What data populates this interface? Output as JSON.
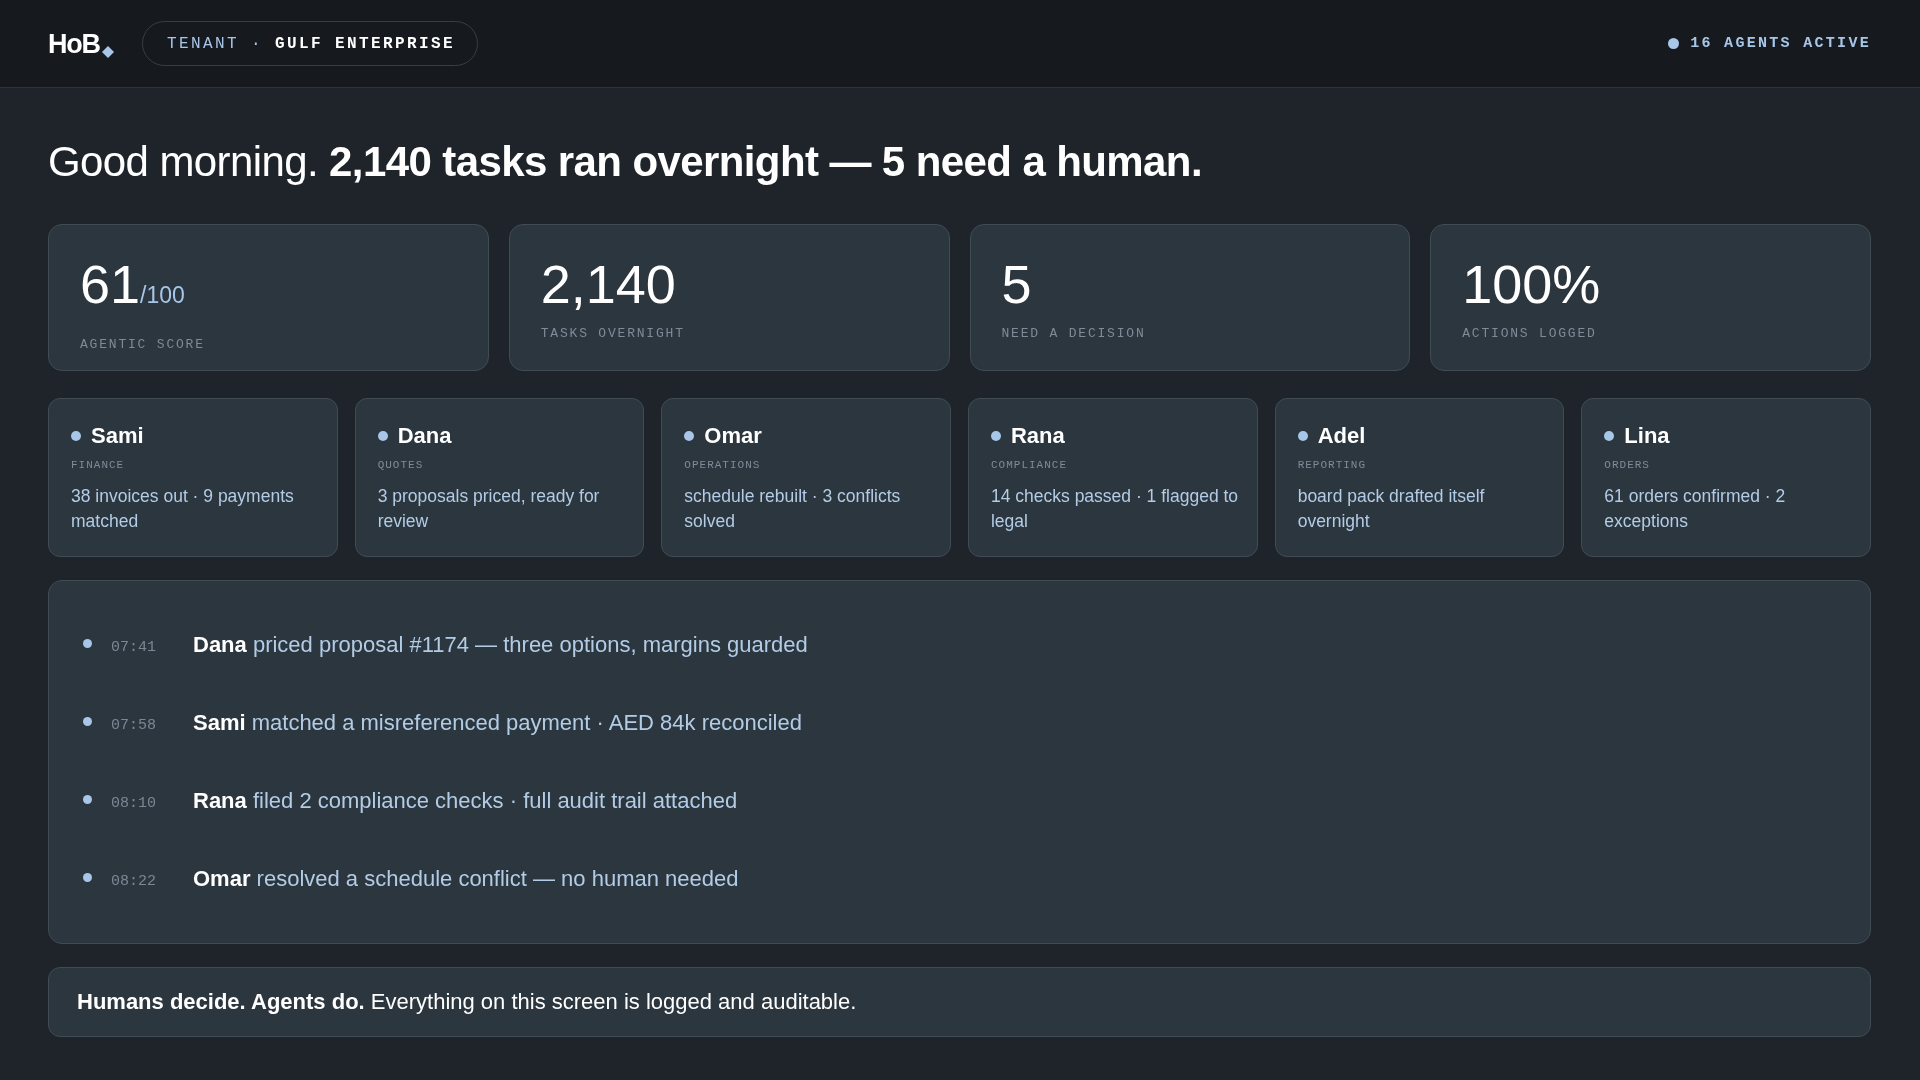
{
  "header": {
    "logo": "HoB",
    "tenant": "TENANT · **GULF ENTERPRISE**",
    "status": "16 AGENTS ACTIVE"
  },
  "greeting": "Good morning. **2,140 tasks ran overnight — 5 need a human.**",
  "stats": [
    {
      "value": "61",
      "suffix": "/100",
      "label": "AGENTIC SCORE"
    },
    {
      "value": "2,140",
      "label": "TASKS OVERNIGHT"
    },
    {
      "value": "5",
      "label": "NEED A DECISION"
    },
    {
      "value": "100%",
      "label": "ACTIONS LOGGED"
    }
  ],
  "agents": [
    {
      "name": "Sami",
      "role": "FINANCE",
      "summary": "38 invoices out · 9 payments matched"
    },
    {
      "name": "Dana",
      "role": "QUOTES",
      "summary": "3 proposals priced, ready for review"
    },
    {
      "name": "Omar",
      "role": "OPERATIONS",
      "summary": "schedule rebuilt · 3 conflicts solved"
    },
    {
      "name": "Rana",
      "role": "COMPLIANCE",
      "summary": "14 checks passed · 1 flagged to legal"
    },
    {
      "name": "Adel",
      "role": "REPORTING",
      "summary": "board pack drafted itself overnight"
    },
    {
      "name": "Lina",
      "role": "ORDERS",
      "summary": "61 orders confirmed · 2 exceptions"
    }
  ],
  "activity": [
    {
      "time": "07:41",
      "text": "**Dana** priced proposal #1174 — three options, margins guarded"
    },
    {
      "time": "07:58",
      "text": "**Sami** matched a misreferenced payment · AED 84k reconciled"
    },
    {
      "time": "08:10",
      "text": "**Rana** filed 2 compliance checks · full audit trail attached"
    },
    {
      "time": "08:22",
      "text": "**Omar** resolved a schedule conflict — no human needed"
    }
  ],
  "footer": "**Humans decide. Agents do.** Everything on this screen is logged and auditable."
}
